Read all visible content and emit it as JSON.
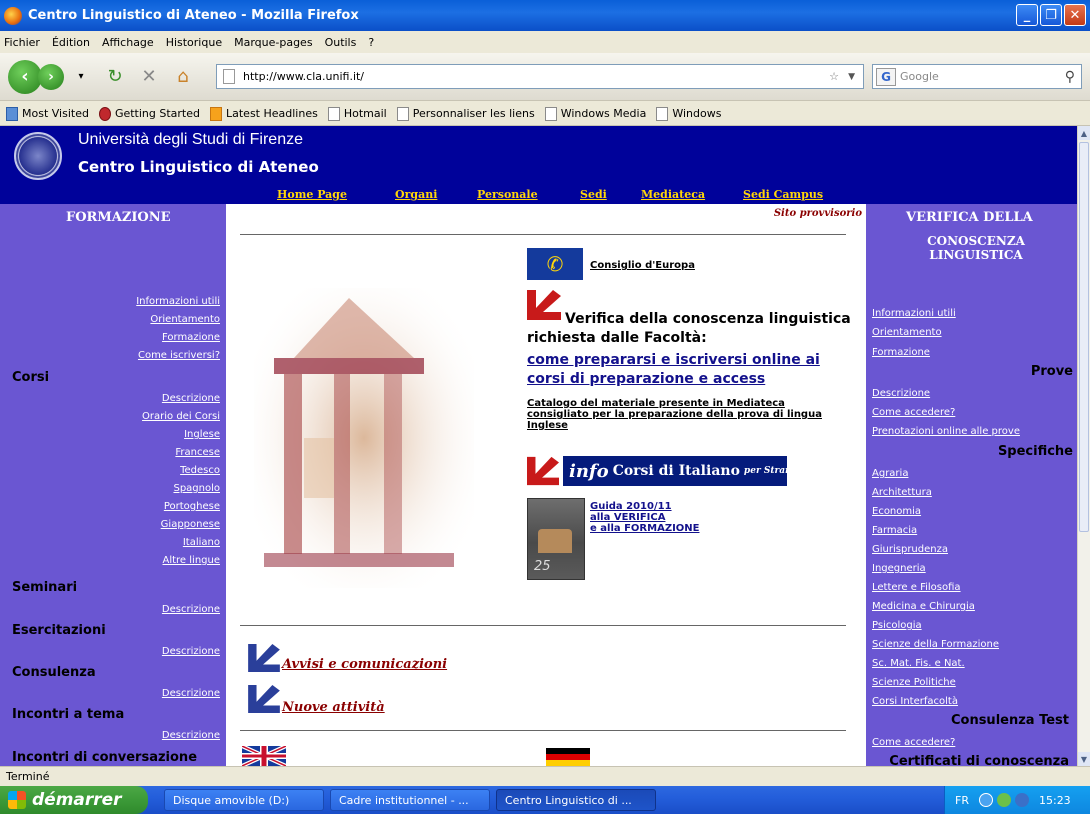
{
  "window": {
    "title": "Centro Linguistico di Ateneo - Mozilla Firefox"
  },
  "menu": [
    "Fichier",
    "Édition",
    "Affichage",
    "Historique",
    "Marque-pages",
    "Outils",
    "?"
  ],
  "address": {
    "url": "http://www.cla.unifi.it/",
    "search_placeholder": "Google"
  },
  "bookmarks": [
    "Most Visited",
    "Getting Started",
    "Latest Headlines",
    "Hotmail",
    "Personnaliser les liens",
    "Windows Media",
    "Windows"
  ],
  "site": {
    "university": "Università degli Studi di Firenze",
    "centre": "Centro Linguistico di Ateneo",
    "nav": [
      "Home Page",
      "Organi",
      "Personale",
      "Sedi",
      "Mediateca",
      "Sedi Campus"
    ],
    "provisional": "Sito provvisorio"
  },
  "left": {
    "heading": "FORMAZIONE",
    "top_links": [
      "Informazioni utili",
      "Orientamento",
      "Formazione",
      "Come iscriversi?"
    ],
    "corsi": "Corsi",
    "corsi_links": [
      "Descrizione",
      "Orario dei Corsi",
      "Inglese",
      "Francese",
      "Tedesco",
      "Spagnolo",
      "Portoghese",
      "Giapponese",
      "Italiano",
      "Altre lingue"
    ],
    "seminari": "Seminari",
    "esercitazioni": "Esercitazioni",
    "consulenza": "Consulenza",
    "incontri_tema": "Incontri a tema",
    "incontri_conv": "Incontri di conversazione",
    "descrizione": "Descrizione"
  },
  "center": {
    "coe_link": "Consiglio d'Europa",
    "verifica_title": "Verifica della conoscenza linguistica richiesta dalle Facoltà:",
    "verifica_link": "come prepararsi e iscriversi online ai corsi di preparazione e access",
    "catalog_link": "Catalogo del materiale presente in Mediateca consigliato per la preparazione della prova di lingua Inglese",
    "info_word": "info",
    "info_text": "Corsi di Italiano",
    "info_sub": "per Stranieri",
    "guida_lines": [
      "Guida 2010/11",
      "alla VERIFICA",
      "e alla FORMAZIONE"
    ],
    "guida_number": "25",
    "avvisi": "Avvisi e comunicazioni",
    "nuove": "Nuove attività"
  },
  "right": {
    "heading1": "VERIFICA DELLA",
    "heading2": "CONOSCENZA LINGUISTICA",
    "top_links": [
      "Informazioni utili",
      "Orientamento",
      "Formazione"
    ],
    "prove": "Prove",
    "prove_links": [
      "Descrizione",
      "Come accedere?",
      "Prenotazioni online alle prove"
    ],
    "specifiche": "Specifiche",
    "spec_links": [
      "Agraria",
      "Architettura",
      "Economia",
      "Farmacia",
      "Giurisprudenza",
      "Ingegneria",
      "Lettere e Filosofia",
      "Medicina e Chirurgia",
      "Psicologia",
      "Scienze della Formazione",
      "Sc. Mat. Fis. e Nat.",
      "Scienze Politiche",
      "Corsi Interfacoltà"
    ],
    "consulenza_test": "Consulenza Test",
    "come_accedere": "Come accedere?",
    "certificati": "Certificati di conoscenza"
  },
  "status": "Terminé",
  "taskbar": {
    "start": "démarrer",
    "tasks": [
      "Disque amovible (D:)",
      "Cadre institutionnel - ...",
      "Centro Linguistico di ..."
    ],
    "lang": "FR",
    "clock": "15:23"
  },
  "colors": {
    "header": "#00029a",
    "sidebar": "#6a56d2",
    "nav_link": "#ffd60a"
  }
}
